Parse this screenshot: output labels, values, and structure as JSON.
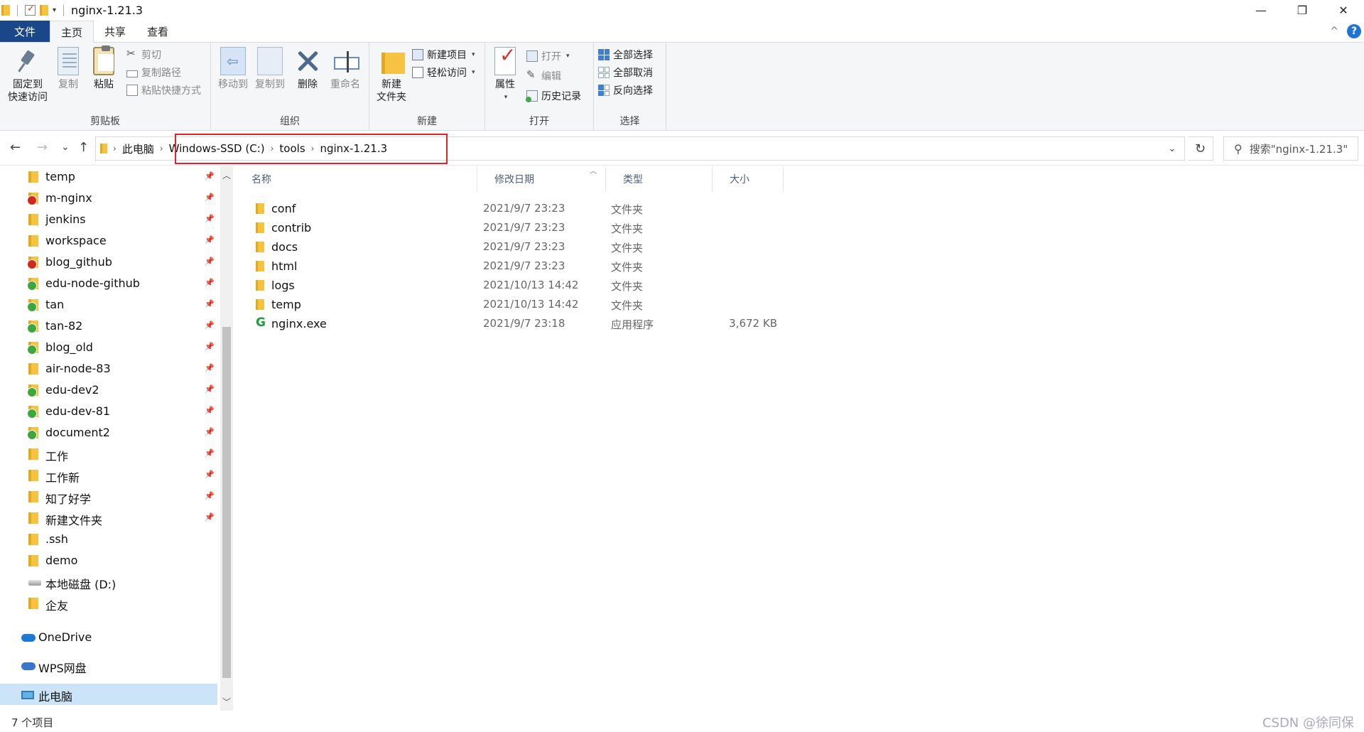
{
  "window": {
    "title": "nginx-1.21.3",
    "minimize": "—",
    "restore": "❐",
    "close": "✕"
  },
  "tabs": {
    "file": "文件",
    "home": "主页",
    "share": "共享",
    "view": "查看",
    "help": "?",
    "collapse": "^"
  },
  "ribbon": {
    "clipboard": {
      "label": "剪贴板",
      "pin_line1": "固定到",
      "pin_line2": "快速访问",
      "copy": "复制",
      "paste": "粘贴",
      "cut": "剪切",
      "copy_path": "复制路径",
      "paste_shortcut": "粘贴快捷方式"
    },
    "organize": {
      "label": "组织",
      "move_to": "移动到",
      "copy_to": "复制到",
      "delete": "删除",
      "rename": "重命名"
    },
    "new": {
      "label": "新建",
      "new_folder_line1": "新建",
      "new_folder_line2": "文件夹",
      "new_item": "新建项目",
      "easy_access": "轻松访问"
    },
    "open": {
      "label": "打开",
      "properties": "属性",
      "open": "打开",
      "edit": "编辑",
      "history": "历史记录"
    },
    "select": {
      "label": "选择",
      "select_all": "全部选择",
      "select_none": "全部取消",
      "invert": "反向选择"
    }
  },
  "address": {
    "back": "←",
    "forward": "→",
    "recent": "⌄",
    "up": "↑",
    "crumbs": [
      "此电脑",
      "Windows-SSD (C:)",
      "tools",
      "nginx-1.21.3"
    ],
    "refresh": "↻",
    "search_placeholder": "搜索\"nginx-1.21.3\""
  },
  "nav": {
    "items": [
      {
        "label": "temp",
        "icon": "folder-icon",
        "pinned": true
      },
      {
        "label": "m-nginx",
        "icon": "git-conflict-folder-icon",
        "pinned": true
      },
      {
        "label": "jenkins",
        "icon": "folder-icon",
        "pinned": true
      },
      {
        "label": "workspace",
        "icon": "folder-icon",
        "pinned": true
      },
      {
        "label": "blog_github",
        "icon": "git-conflict-folder-icon",
        "pinned": true
      },
      {
        "label": "edu-node-github",
        "icon": "git-clean-folder-icon",
        "pinned": true
      },
      {
        "label": "tan",
        "icon": "git-clean-folder-icon",
        "pinned": true
      },
      {
        "label": "tan-82",
        "icon": "git-clean-folder-icon",
        "pinned": true
      },
      {
        "label": "blog_old",
        "icon": "git-clean-folder-icon",
        "pinned": true
      },
      {
        "label": "air-node-83",
        "icon": "folder-icon",
        "pinned": true
      },
      {
        "label": "edu-dev2",
        "icon": "git-clean-folder-icon",
        "pinned": true
      },
      {
        "label": "edu-dev-81",
        "icon": "git-clean-folder-icon",
        "pinned": true
      },
      {
        "label": "document2",
        "icon": "git-clean-folder-icon",
        "pinned": true
      },
      {
        "label": "工作",
        "icon": "folder-icon",
        "pinned": true
      },
      {
        "label": "工作新",
        "icon": "folder-icon",
        "pinned": true
      },
      {
        "label": "知了好学",
        "icon": "folder-icon",
        "pinned": true
      },
      {
        "label": "新建文件夹",
        "icon": "folder-icon",
        "pinned": true
      },
      {
        "label": ".ssh",
        "icon": "folder-icon",
        "pinned": false
      },
      {
        "label": "demo",
        "icon": "folder-icon",
        "pinned": false
      },
      {
        "label": "本地磁盘 (D:)",
        "icon": "drive-icon",
        "pinned": false
      },
      {
        "label": "企友",
        "icon": "folder-icon",
        "pinned": false
      }
    ],
    "onedrive": "OneDrive",
    "wps": "WPS网盘",
    "this_pc": "此电脑"
  },
  "columns": {
    "name": "名称",
    "date": "修改日期",
    "type": "类型",
    "size": "大小"
  },
  "files": [
    {
      "name": "conf",
      "date": "2021/9/7 23:23",
      "type": "文件夹",
      "size": "",
      "icon": "folder-icon"
    },
    {
      "name": "contrib",
      "date": "2021/9/7 23:23",
      "type": "文件夹",
      "size": "",
      "icon": "folder-icon"
    },
    {
      "name": "docs",
      "date": "2021/9/7 23:23",
      "type": "文件夹",
      "size": "",
      "icon": "folder-icon"
    },
    {
      "name": "html",
      "date": "2021/9/7 23:23",
      "type": "文件夹",
      "size": "",
      "icon": "folder-icon"
    },
    {
      "name": "logs",
      "date": "2021/10/13 14:42",
      "type": "文件夹",
      "size": "",
      "icon": "folder-icon"
    },
    {
      "name": "temp",
      "date": "2021/10/13 14:42",
      "type": "文件夹",
      "size": "",
      "icon": "folder-icon"
    },
    {
      "name": "nginx.exe",
      "date": "2021/9/7 23:18",
      "type": "应用程序",
      "size": "3,672 KB",
      "icon": "nginx-exe-icon"
    }
  ],
  "status": {
    "count": "7 个项目",
    "watermark": "CSDN @徐同保"
  },
  "colors": {
    "file_tab": "#19478a",
    "highlight_border": "#e0232c",
    "selection": "#cce4f7",
    "folder": "#f5c242"
  }
}
